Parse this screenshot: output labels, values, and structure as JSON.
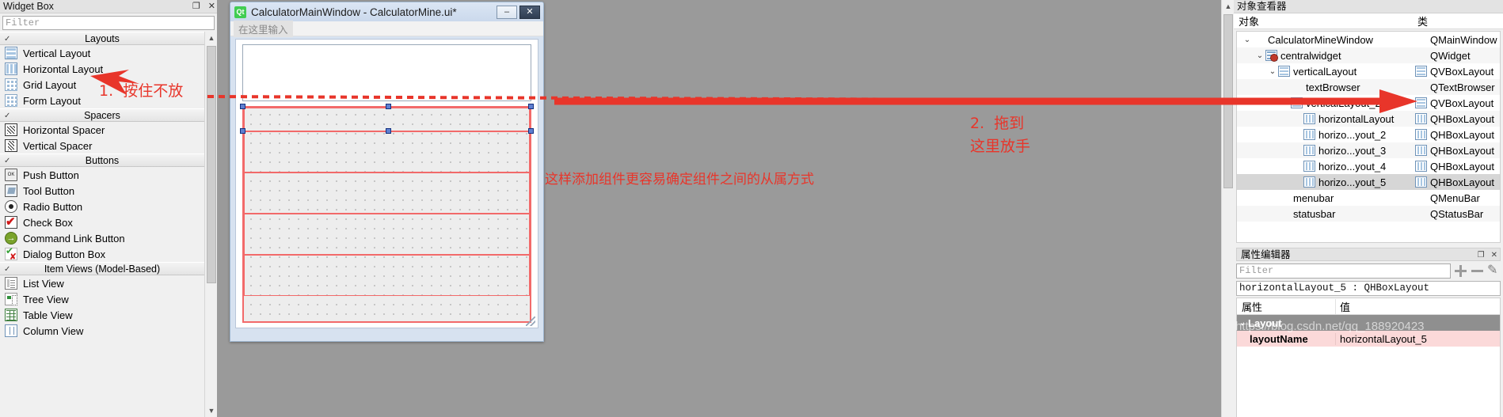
{
  "widget_box": {
    "title": "Widget Box",
    "dock_buttons": [
      "❐",
      "✕"
    ],
    "filter_placeholder": "Filter",
    "groups": [
      {
        "name": "Layouts",
        "items": [
          {
            "label": "Vertical Layout",
            "icon": "vertical-layout-icon"
          },
          {
            "label": "Horizontal Layout",
            "icon": "horizontal-layout-icon"
          },
          {
            "label": "Grid Layout",
            "icon": "grid-layout-icon"
          },
          {
            "label": "Form Layout",
            "icon": "form-layout-icon"
          }
        ]
      },
      {
        "name": "Spacers",
        "items": [
          {
            "label": "Horizontal Spacer",
            "icon": "horizontal-spacer-icon"
          },
          {
            "label": "Vertical Spacer",
            "icon": "vertical-spacer-icon"
          }
        ]
      },
      {
        "name": "Buttons",
        "items": [
          {
            "label": "Push Button",
            "icon": "push-button-icon"
          },
          {
            "label": "Tool Button",
            "icon": "tool-button-icon"
          },
          {
            "label": "Radio Button",
            "icon": "radio-button-icon"
          },
          {
            "label": "Check Box",
            "icon": "check-box-icon"
          },
          {
            "label": "Command Link Button",
            "icon": "command-link-button-icon"
          },
          {
            "label": "Dialog Button Box",
            "icon": "dialog-button-box-icon"
          }
        ]
      },
      {
        "name": "Item Views (Model-Based)",
        "items": [
          {
            "label": "List View",
            "icon": "list-view-icon"
          },
          {
            "label": "Tree View",
            "icon": "tree-view-icon"
          },
          {
            "label": "Table View",
            "icon": "table-view-icon"
          },
          {
            "label": "Column View",
            "icon": "column-view-icon"
          }
        ]
      }
    ]
  },
  "form_window": {
    "logo_text": "Qt",
    "title": "CalculatorMainWindow - CalculatorMine.ui*",
    "minimize_label": "–",
    "close_label": "✕",
    "menubar_placeholder": "在这里输入"
  },
  "mdi_note": "这样添加组件更容易确定组件之间的从属方式",
  "annotations": {
    "step1": "1.  按住不放",
    "step2_line1": "2.  拖到",
    "step2_line2": "这里放手",
    "arrow_color": "#e8352a"
  },
  "object_inspector": {
    "title": "对象查看器",
    "columns": [
      "对象",
      "类"
    ],
    "rows": [
      {
        "name": "CalculatorMineWindow",
        "class": "QMainWindow",
        "indent": 0,
        "chevron": "⌄",
        "icon": "none",
        "class_icon": "none",
        "selected": false
      },
      {
        "name": "centralwidget",
        "class": "QWidget",
        "indent": 1,
        "chevron": "⌄",
        "icon": "central",
        "class_icon": "none",
        "selected": false
      },
      {
        "name": "verticalLayout",
        "class": "QVBoxLayout",
        "indent": 2,
        "chevron": "⌄",
        "icon": "vbox",
        "class_icon": "vbox",
        "selected": false
      },
      {
        "name": "textBrowser",
        "class": "QTextBrowser",
        "indent": 3,
        "chevron": "",
        "icon": "none",
        "class_icon": "none",
        "selected": false
      },
      {
        "name": "verticalLayout_2",
        "class": "QVBoxLayout",
        "indent": 3,
        "chevron": "",
        "icon": "vbox",
        "class_icon": "vbox",
        "selected": false
      },
      {
        "name": "horizontalLayout",
        "class": "QHBoxLayout",
        "indent": 4,
        "chevron": "",
        "icon": "hbox",
        "class_icon": "hbox",
        "selected": false
      },
      {
        "name": "horizo...yout_2",
        "class": "QHBoxLayout",
        "indent": 4,
        "chevron": "",
        "icon": "hbox",
        "class_icon": "hbox",
        "selected": false
      },
      {
        "name": "horizo...yout_3",
        "class": "QHBoxLayout",
        "indent": 4,
        "chevron": "",
        "icon": "hbox",
        "class_icon": "hbox",
        "selected": false
      },
      {
        "name": "horizo...yout_4",
        "class": "QHBoxLayout",
        "indent": 4,
        "chevron": "",
        "icon": "hbox",
        "class_icon": "hbox",
        "selected": false
      },
      {
        "name": "horizo...yout_5",
        "class": "QHBoxLayout",
        "indent": 4,
        "chevron": "",
        "icon": "hbox",
        "class_icon": "hbox",
        "selected": true
      },
      {
        "name": "menubar",
        "class": "QMenuBar",
        "indent": 2,
        "chevron": "",
        "icon": "none",
        "class_icon": "none",
        "selected": false
      },
      {
        "name": "statusbar",
        "class": "QStatusBar",
        "indent": 2,
        "chevron": "",
        "icon": "none",
        "class_icon": "none",
        "selected": false
      }
    ]
  },
  "property_editor": {
    "title": "属性编辑器",
    "dock_buttons": [
      "❐",
      "✕"
    ],
    "filter_placeholder": "Filter",
    "add_icon": "plus-icon",
    "remove_icon": "minus-icon",
    "config_icon": "pen-icon",
    "object_line": "horizontalLayout_5 : QHBoxLayout",
    "columns": [
      "属性",
      "值"
    ],
    "group": {
      "chevron": "⌄",
      "label": "Layout"
    },
    "rows": [
      {
        "property": "layoutName",
        "value": "horizontalLayout_5"
      }
    ]
  },
  "watermark": "https://blog.csdn.net/qq_188920423"
}
